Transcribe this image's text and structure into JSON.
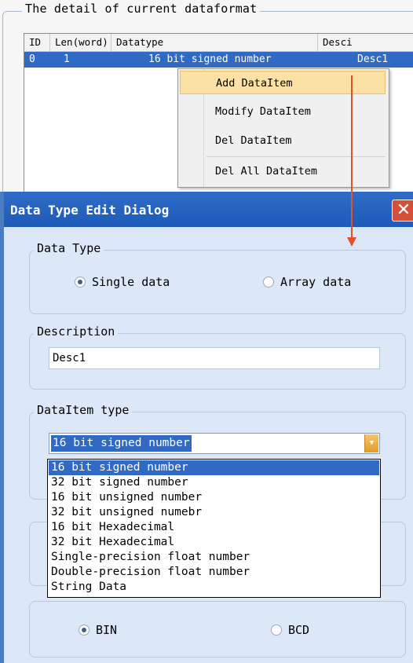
{
  "top_group": {
    "legend": "The detail of current dataformat",
    "columns": [
      "ID",
      "Len(word)",
      "Datatype",
      "Desci"
    ],
    "selected_row": {
      "id": "0",
      "len": "1",
      "datatype": "16 bit signed number",
      "desc": "Desc1"
    }
  },
  "context_menu": {
    "items": [
      "Add DataItem",
      "Modify DataItem",
      "Del DataItem",
      "Del All DataItem"
    ],
    "highlighted_index": 0
  },
  "dialog": {
    "title": "Data Type Edit Dialog",
    "close_glyph": "✕",
    "data_type": {
      "legend": "Data Type",
      "options": [
        "Single data",
        "Array data"
      ],
      "selected": "Single data"
    },
    "description": {
      "legend": "Description",
      "value": "Desc1"
    },
    "dataitem_type": {
      "legend": "DataItem type",
      "selected": "16 bit signed number",
      "options": [
        "16 bit signed number",
        "32 bit signed number",
        "16 bit unsigned number",
        "32 bit unsigned numebr",
        "16 bit Hexadecimal",
        "32 bit Hexadecimal",
        "Single-precision float number",
        "Double-precision float number",
        "String Data"
      ]
    },
    "code_type": {
      "options": [
        "BIN",
        "BCD"
      ],
      "selected": "BIN"
    }
  },
  "colors": {
    "title_bar": "#1e5bb8",
    "selection": "#316ac5",
    "menu_highlight": "#fbe2a4",
    "arrow": "#e0522c",
    "close_button": "#d4503b"
  }
}
